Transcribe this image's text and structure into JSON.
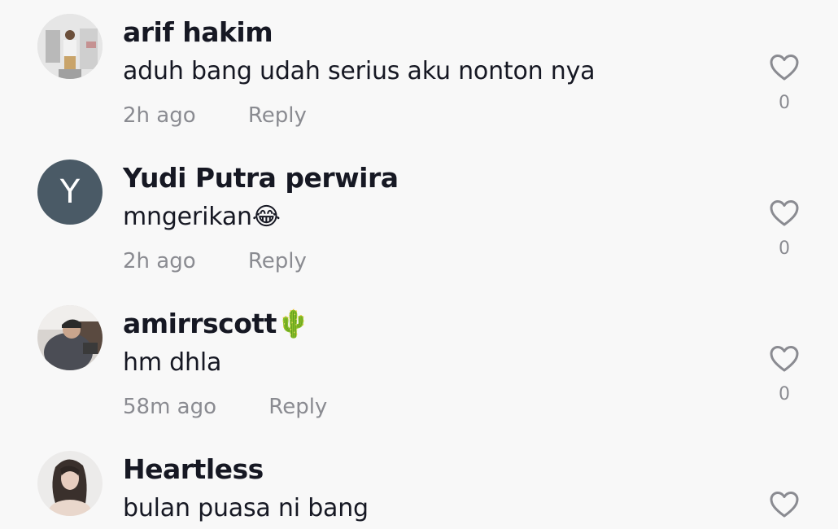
{
  "comments": [
    {
      "username": "arif hakim",
      "text": "aduh bang udah serius aku nonton nya",
      "time": "2h ago",
      "reply_label": "Reply",
      "like_count": "0",
      "avatar": {
        "type": "photo",
        "icon": "avatar-photo"
      }
    },
    {
      "username": "Yudi Putra perwira",
      "text": "mngerikan😂",
      "time": "2h ago",
      "reply_label": "Reply",
      "like_count": "0",
      "avatar": {
        "type": "letter",
        "letter": "Y",
        "color": "#4a5a66"
      }
    },
    {
      "username": "amirrscott🌵",
      "text": "hm dhla",
      "time": "58m ago",
      "reply_label": "Reply",
      "like_count": "0",
      "avatar": {
        "type": "photo",
        "icon": "avatar-photo"
      }
    },
    {
      "username": "Heartless",
      "text": "bulan puasa ni bang",
      "avatar": {
        "type": "photo",
        "icon": "avatar-photo"
      }
    }
  ],
  "icons": {
    "like": "heart-outline-icon"
  },
  "colors": {
    "background": "#f8f8f8",
    "username": "#161823",
    "secondary_text": "#8a8b91",
    "heart_stroke": "#8a8b91"
  }
}
